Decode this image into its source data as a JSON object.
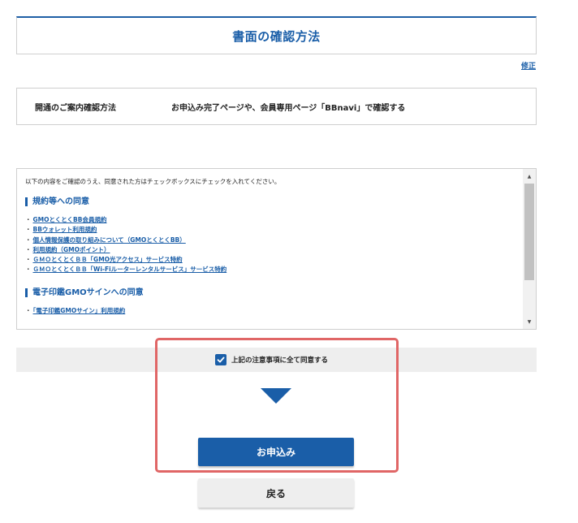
{
  "section": {
    "title": "書面の確認方法"
  },
  "edit_link": "修正",
  "info": {
    "label": "開通のご案内確認方法",
    "value": "お申込み完了ページや、会員専用ページ「BBnavi」で確認する"
  },
  "terms": {
    "intro": "以下の内容をご確認のうえ、同意された方はチェックボックスにチェックを入れてください。",
    "group1": {
      "heading": "規約等への同意",
      "items": [
        "GMOとくとくBB会員規約",
        "BBウォレット利用規約",
        "個人情報保護の取り組みについて（GMOとくとくBB）",
        "利用規約（GMOポイント）",
        "ＧＭＯとくとくＢＢ「GMO光アクセス」サービス特約",
        "ＧＭＯとくとくＢＢ「Wi-Fiルーターレンタルサービス」サービス特約"
      ]
    },
    "group2": {
      "heading": "電子印鑑GMOサインへの同意",
      "items": [
        "「電子印鑑GMOサイン」利用規約"
      ]
    }
  },
  "agree": {
    "label": "上記の注意事項に全て同意する",
    "checked": true
  },
  "buttons": {
    "submit": "お申込み",
    "back": "戻る"
  },
  "colors": {
    "accent": "#1a5ea8",
    "highlight": "#e06666"
  }
}
